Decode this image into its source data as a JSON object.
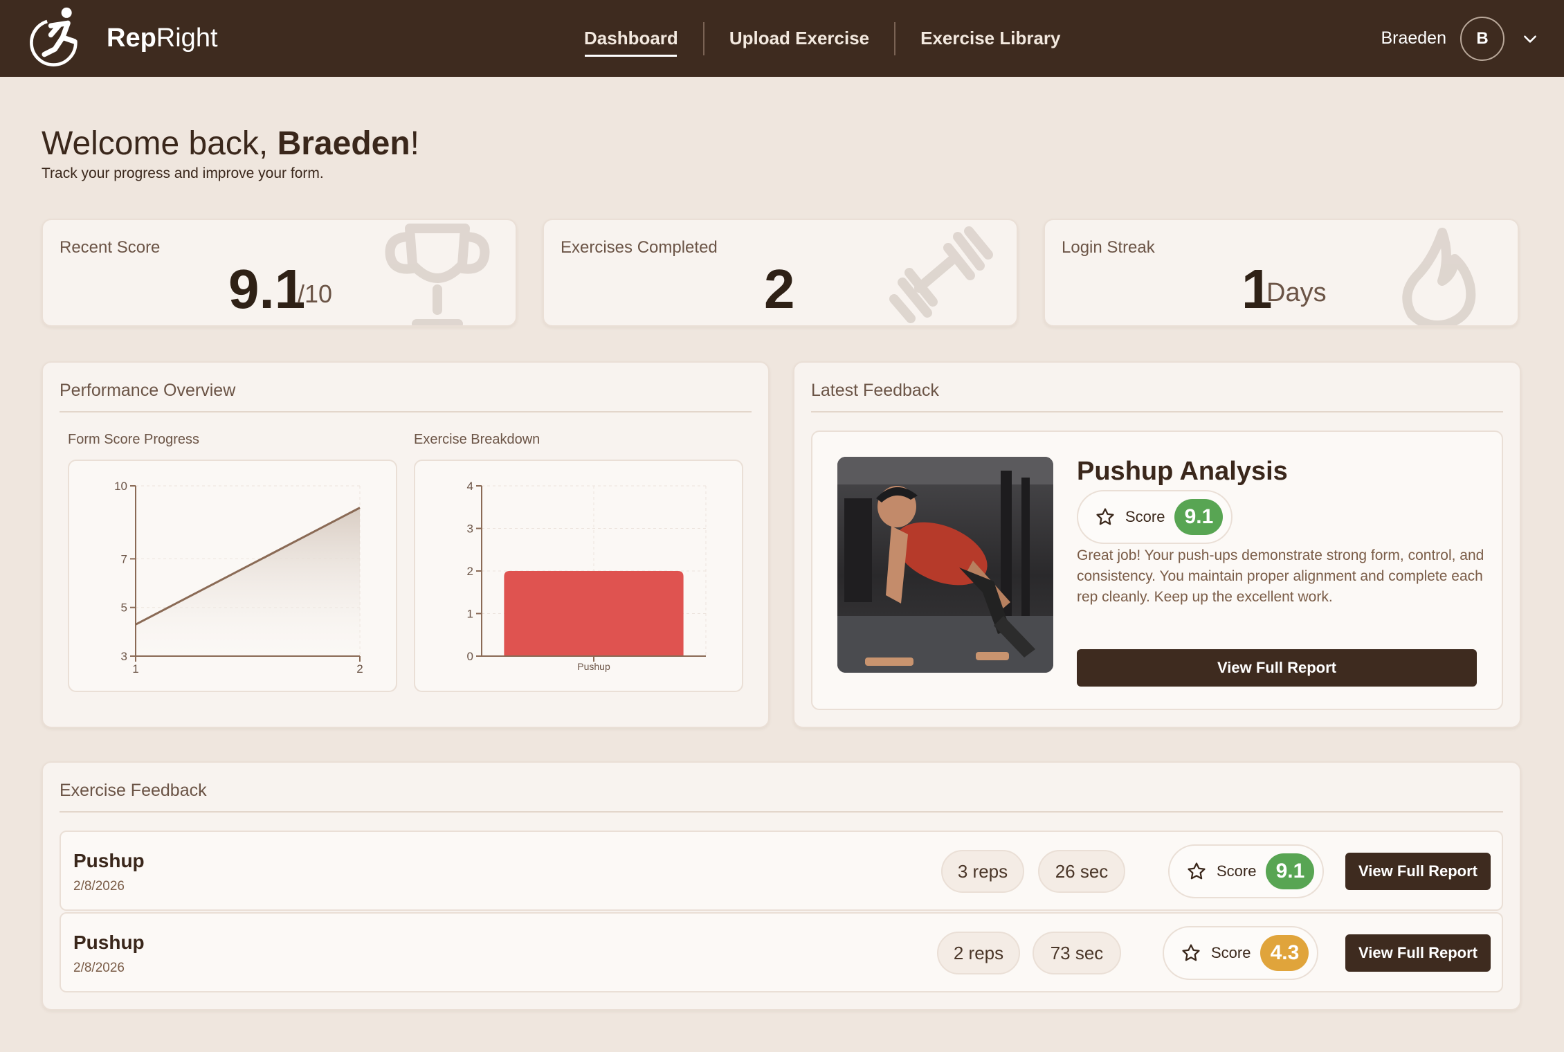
{
  "app": {
    "brand_bold": "Rep",
    "brand_rest": "Right"
  },
  "nav": {
    "items": [
      "Dashboard",
      "Upload Exercise",
      "Exercise Library"
    ],
    "active": "Dashboard"
  },
  "user": {
    "name": "Braeden",
    "initial": "B"
  },
  "welcome": {
    "prefix": "Welcome back, ",
    "name": "Braeden",
    "suffix": "!",
    "subtitle": "Track your progress and improve your form."
  },
  "stats": {
    "recent_score": {
      "label": "Recent Score",
      "value": "9.1",
      "unit": "/10"
    },
    "exercises_completed": {
      "label": "Exercises Completed",
      "value": "2"
    },
    "login_streak": {
      "label": "Login Streak",
      "value": "1",
      "unit": "Days"
    }
  },
  "performance": {
    "title": "Performance Overview",
    "form_score_label": "Form Score Progress",
    "breakdown_label": "Exercise Breakdown"
  },
  "chart_data": [
    {
      "type": "area",
      "title": "Form Score Progress",
      "x": [
        1,
        2
      ],
      "values": [
        4.3,
        9.1
      ],
      "ylim": [
        3,
        10
      ],
      "xlim": [
        1,
        2
      ],
      "y_ticks": [
        3,
        5,
        7,
        10
      ],
      "x_ticks": [
        1,
        2
      ],
      "color": "#8a6a55",
      "grid": true
    },
    {
      "type": "bar",
      "title": "Exercise Breakdown",
      "categories": [
        "Pushup"
      ],
      "values": [
        2
      ],
      "ylim": [
        0,
        4
      ],
      "y_ticks": [
        0,
        1,
        2,
        3,
        4
      ],
      "color": "#df5350",
      "grid": true
    }
  ],
  "latest_feedback": {
    "title": "Latest Feedback",
    "exercise_title": "Pushup Analysis",
    "score_label": "Score",
    "score": "9.1",
    "text": "Great job! Your push-ups demonstrate strong form, control, and consistency. You maintain proper alignment and complete each rep cleanly. Keep up the excellent work.",
    "button": "View Full Report"
  },
  "exercise_feedback": {
    "title": "Exercise Feedback",
    "rows": [
      {
        "name": "Pushup",
        "date": "2/8/2026",
        "reps": "3 reps",
        "duration": "26 sec",
        "score_label": "Score",
        "score": "9.1",
        "score_color": "#58a553",
        "button": "View Full Report"
      },
      {
        "name": "Pushup",
        "date": "2/8/2026",
        "reps": "2 reps",
        "duration": "73 sec",
        "score_label": "Score",
        "score": "4.3",
        "score_color": "#e0a43b",
        "button": "View Full Report"
      }
    ]
  },
  "colors": {
    "header": "#3e2b1f",
    "background": "#efe6de",
    "good": "#58a553",
    "warn": "#e0a43b",
    "bar": "#df5350"
  }
}
